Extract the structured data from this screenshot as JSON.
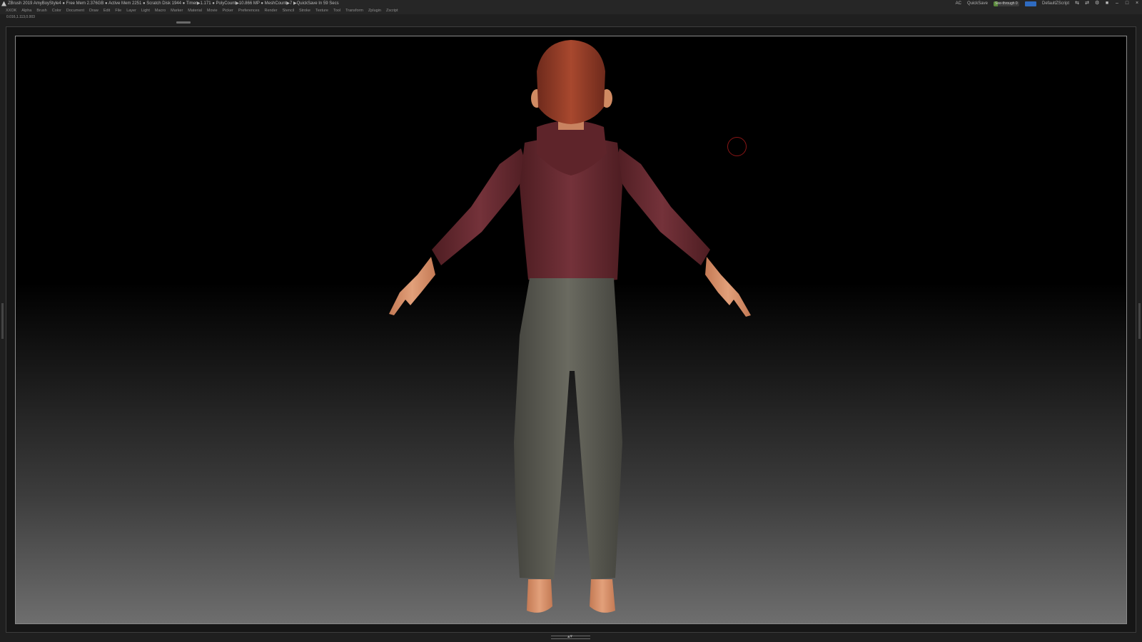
{
  "titlebar": {
    "status": "ZBrush 2019   AmyBoyStyle4   ● Free Mem 2.376GB ● Active Mem 2251 ● Scratch Disk 1944 ● Timer▶1.171 ● PolyCount▶10.866 MP ● MeshCount▶7  ▶QuickSave In 59 Secs",
    "ac": "AC",
    "quicksave": "QuickSave",
    "seethrough_label": "See-through  0",
    "seethrough_value": 0,
    "menus_label": "Menus",
    "script": "DefaultZScript"
  },
  "menubar": {
    "items": [
      "XXOK",
      "Alpha",
      "Brush",
      "Color",
      "Document",
      "Draw",
      "Edit",
      "File",
      "Layer",
      "Light",
      "Macro",
      "Marker",
      "Material",
      "Movie",
      "Picker",
      "Preferences",
      "Render",
      "Stencil",
      "Stroke",
      "Texture",
      "Tool",
      "Transform",
      "Zplugin",
      "Zscript"
    ]
  },
  "coords": "0.016,1.113,0.003",
  "colors": {
    "hoodie": "#6b2b30",
    "pants": "#5e5e55",
    "skin": "#d9926a",
    "hair": "#8a3a26",
    "brush_cursor": "#8a1616"
  }
}
